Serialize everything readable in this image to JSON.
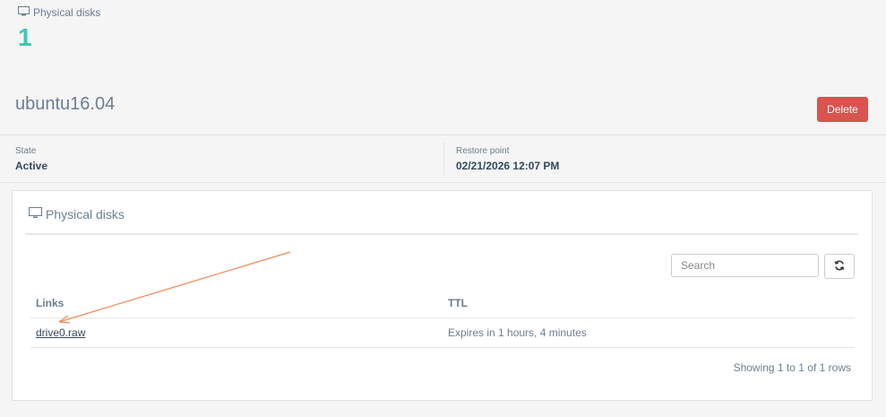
{
  "stat": {
    "title": "Physical disks",
    "value": "1",
    "icon": "monitor-icon"
  },
  "header": {
    "title": "ubuntu16.04",
    "delete_label": "Delete"
  },
  "info": {
    "state_label": "State",
    "state_value": "Active",
    "restore_label": "Restore point",
    "restore_value": "02/21/2026 12:07 PM"
  },
  "panel": {
    "title": "Physical disks",
    "icon": "monitor-icon",
    "search_placeholder": "Search",
    "refresh_icon": "refresh-icon",
    "columns": [
      "Links",
      "TTL"
    ],
    "rows": [
      {
        "link": "drive0.raw",
        "ttl": "Expires in 1 hours, 4 minutes"
      }
    ],
    "rows_info": "Showing 1 to 1 of 1 rows"
  },
  "colors": {
    "accent": "#3bc8b5",
    "danger": "#d9534f",
    "annotation_arrow": "#f0875a"
  }
}
